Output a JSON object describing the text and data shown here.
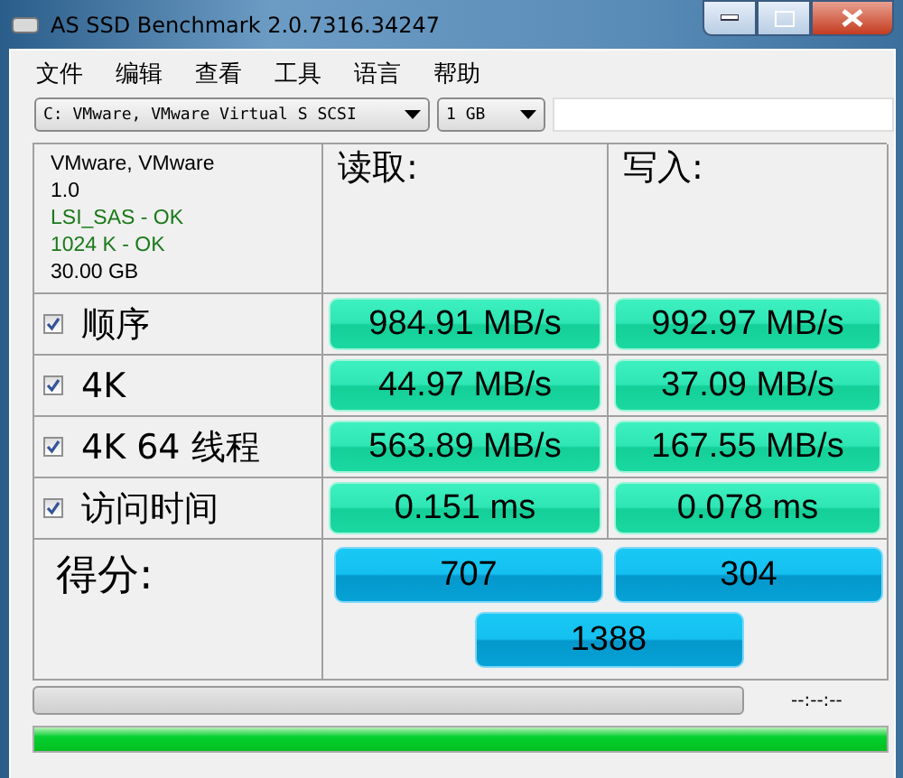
{
  "window": {
    "title": "AS SSD Benchmark 2.0.7316.34247"
  },
  "menu": [
    "文件",
    "编辑",
    "查看",
    "工具",
    "语言",
    "帮助"
  ],
  "drive_select": {
    "value": "C: VMware, VMware Virtual S SCSI"
  },
  "size_select": {
    "value": "1 GB"
  },
  "drive_info": [
    {
      "text": "VMware, VMware",
      "kind": "plain"
    },
    {
      "text": "1.0",
      "kind": "plain"
    },
    {
      "text": "LSI_SAS - OK",
      "kind": "ok"
    },
    {
      "text": "1024 K - OK",
      "kind": "ok"
    },
    {
      "text": "30.00 GB",
      "kind": "plain"
    }
  ],
  "columns": [
    "读取:",
    "写入:"
  ],
  "tests": [
    {
      "label": "顺序",
      "checked": true,
      "read": "984.91 MB/s",
      "write": "992.97 MB/s"
    },
    {
      "label": "4K",
      "checked": true,
      "read": "44.97 MB/s",
      "write": "37.09 MB/s"
    },
    {
      "label": "4K 64 线程",
      "checked": true,
      "read": "563.89 MB/s",
      "write": "167.55 MB/s"
    },
    {
      "label": "访问时间",
      "checked": true,
      "read": "0.151 ms",
      "write": "0.078 ms"
    }
  ],
  "score": {
    "label": "得分:",
    "read": "707",
    "write": "304",
    "total": "1388"
  },
  "progress": {
    "level": 0,
    "time": "--:--:--"
  },
  "overall_progress": {
    "level": 1
  }
}
